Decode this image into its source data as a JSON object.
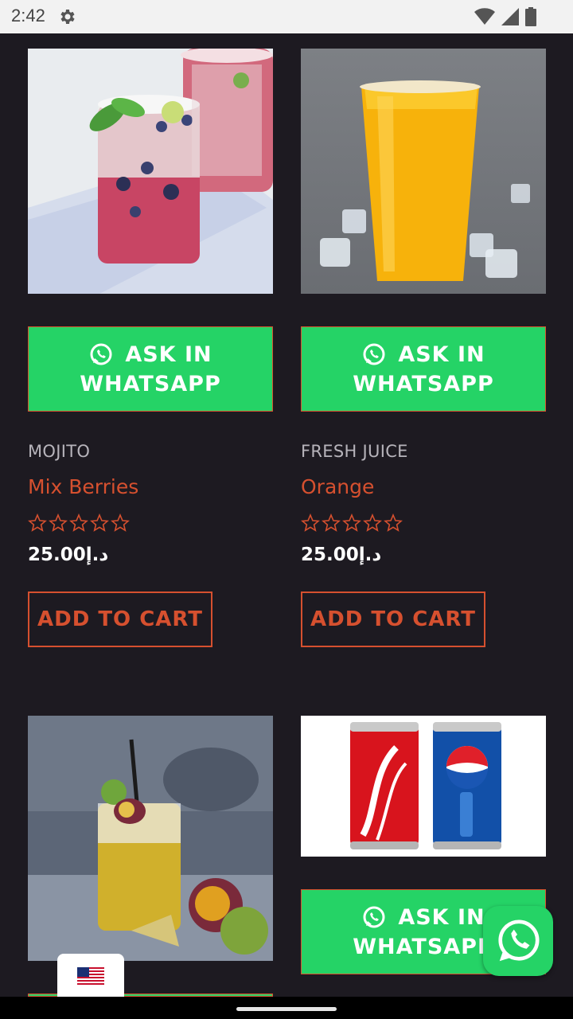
{
  "status_bar": {
    "time": "2:42",
    "icons": [
      "gear-icon",
      "wifi-icon",
      "signal-icon",
      "battery-icon"
    ]
  },
  "colors": {
    "accent": "#d6502f",
    "whatsapp_green": "#25d366",
    "background": "#1d1a21"
  },
  "products": [
    {
      "category": "MOJITO",
      "title": "Mix Berries",
      "rating": 0,
      "rating_max": 5,
      "price": "25.00د.إ",
      "wa_line1": "ASK IN",
      "wa_line2": "WHATSAPP",
      "add_to_cart": "ADD TO CART",
      "image": "mojito-berries-drink"
    },
    {
      "category": "FRESH JUICE",
      "title": "Orange",
      "rating": 0,
      "rating_max": 5,
      "price": "25.00د.إ",
      "wa_line1": "ASK IN",
      "wa_line2": "WHATSAPP",
      "add_to_cart": "ADD TO CART",
      "image": "orange-juice-cup"
    },
    {
      "image": "passion-fruit-mojito"
    },
    {
      "wa_line1": "ASK IN",
      "wa_line2": "WHATSAPP",
      "image": "coca-cola-and-pepsi-cans"
    }
  ],
  "language": {
    "flag": "us-flag-icon"
  },
  "floating_button": {
    "icon": "whatsapp-icon"
  }
}
